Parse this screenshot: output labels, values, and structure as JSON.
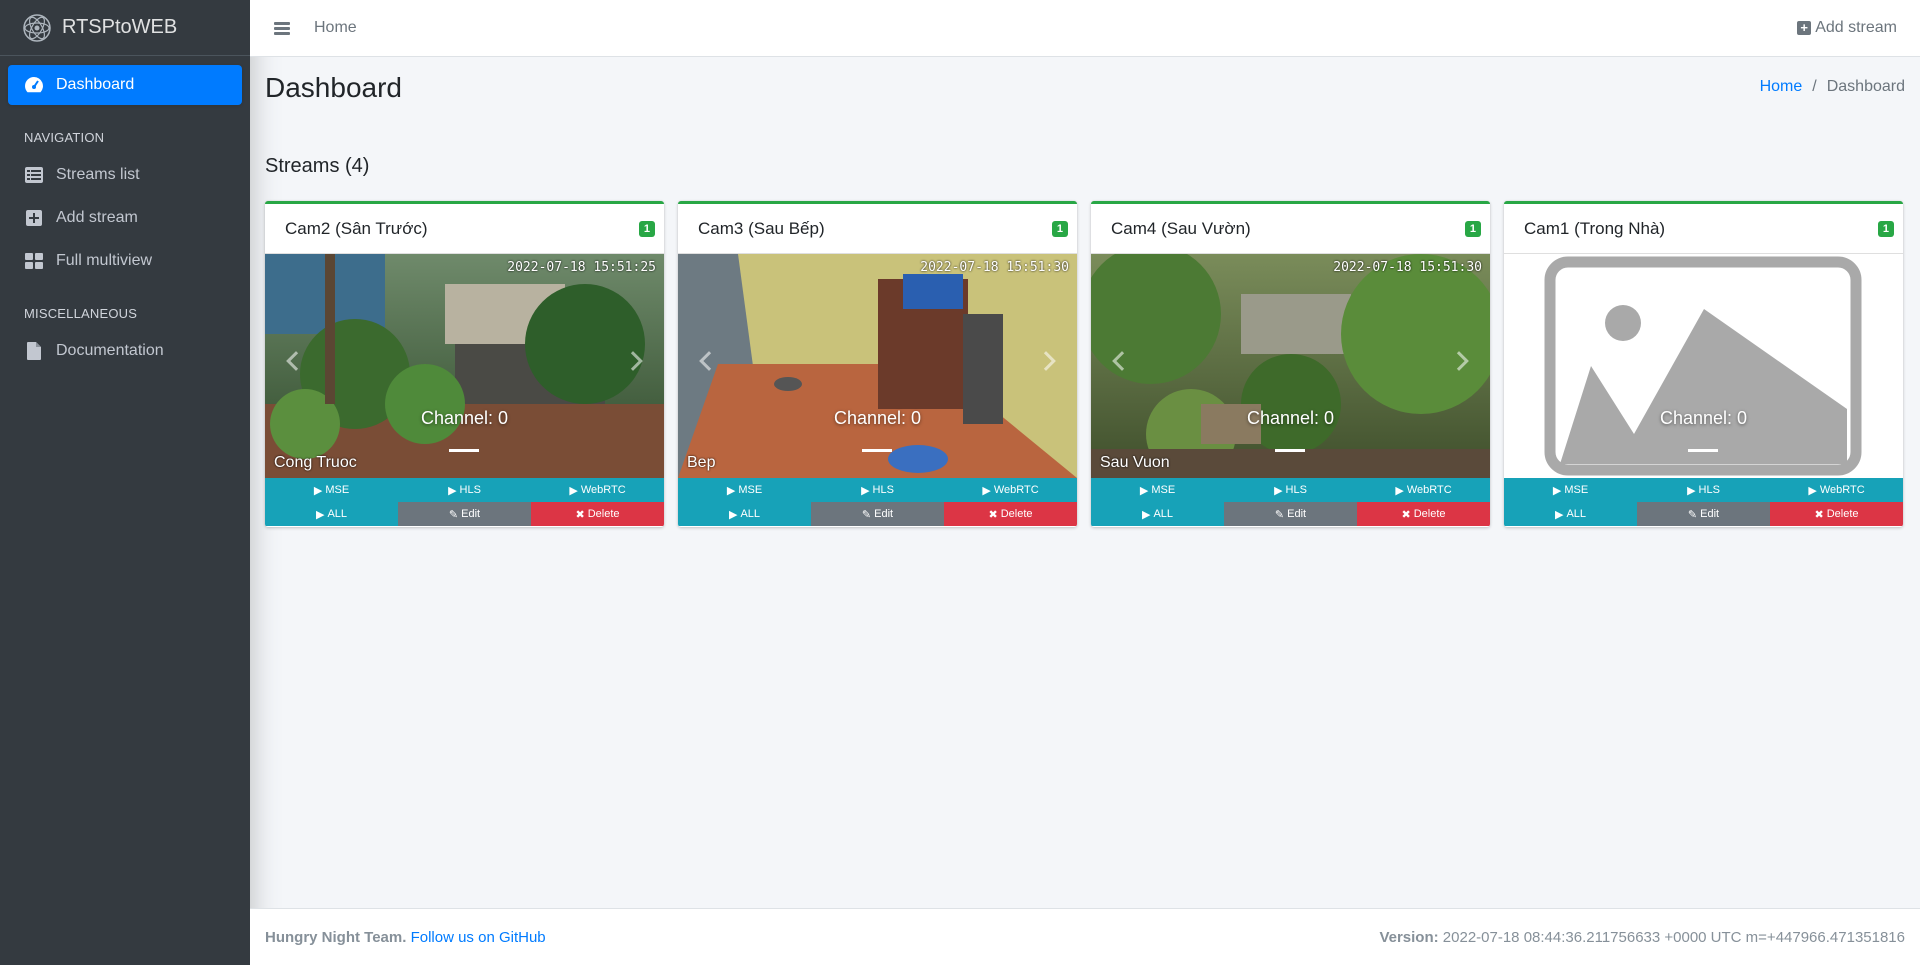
{
  "brand": {
    "name": "RTSPtoWEB"
  },
  "sidebar": {
    "active_item": "Dashboard",
    "nav_header": "NAVIGATION",
    "nav_items": [
      "Streams list",
      "Add stream",
      "Full multiview"
    ],
    "misc_header": "MISCELLANEOUS",
    "misc_items": [
      "Documentation"
    ]
  },
  "topbar": {
    "home": "Home",
    "add_stream": "Add stream"
  },
  "page": {
    "title": "Dashboard",
    "breadcrumb": {
      "home": "Home",
      "separator": "/",
      "current": "Dashboard"
    },
    "section_title": "Streams (4)"
  },
  "streams": [
    {
      "title": "Cam2 (Sân Trước)",
      "badge": "1",
      "timestamp": "2022-07-18 15:51:25",
      "cam_label": "Cong Truoc",
      "channel": "Channel: 0"
    },
    {
      "title": "Cam3 (Sau Bếp)",
      "badge": "1",
      "timestamp": "2022-07-18 15:51:30",
      "cam_label": "Bep",
      "channel": "Channel: 0"
    },
    {
      "title": "Cam4 (Sau Vườn)",
      "badge": "1",
      "timestamp": "2022-07-18 15:51:30",
      "cam_label": "Sau Vuon",
      "channel": "Channel: 0"
    },
    {
      "title": "Cam1 (Trong Nhà)",
      "badge": "1",
      "timestamp": "",
      "cam_label": "",
      "channel": "Channel: 0"
    }
  ],
  "buttons": {
    "mse": "MSE",
    "hls": "HLS",
    "webrtc": "WebRTC",
    "all": "ALL",
    "edit": "Edit",
    "delete": "Delete"
  },
  "footer": {
    "team": "Hungry Night Team.",
    "github": "Follow us on GitHub",
    "version_label": "Version:",
    "version": "2022-07-18 08:44:36.211756633 +0000 UTC m=+447966.471351816"
  },
  "colors": {
    "sidebar": "#343a40",
    "primary": "#007bff",
    "success": "#28a745",
    "info": "#17a2b8",
    "secondary": "#6c757d",
    "danger": "#dc3545"
  }
}
